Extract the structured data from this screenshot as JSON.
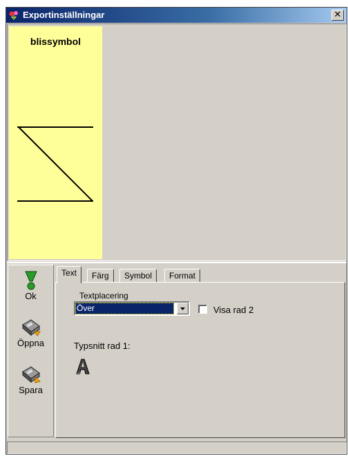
{
  "window": {
    "title": "Exportinställningar",
    "close_label": "✕"
  },
  "preview": {
    "symbol_title": "blissymbol",
    "card_color": "#ffff99"
  },
  "toolbar": {
    "ok_label": "Ok",
    "open_label": "Öppna",
    "save_label": "Spara"
  },
  "tabs": [
    {
      "label": "Text",
      "active": true
    },
    {
      "label": "Färg",
      "active": false
    },
    {
      "label": "Symbol",
      "active": false
    },
    {
      "label": "Format",
      "active": false
    }
  ],
  "text_tab": {
    "placement_label": "Textplacering",
    "placement_value": "Över",
    "show_row2_label": "Visa rad 2",
    "show_row2_checked": false,
    "font_row1_label": "Typsnitt rad 1:"
  },
  "colors": {
    "titlebar": "#0a246a",
    "selection": "#0a246a",
    "face": "#d4d0c8"
  }
}
